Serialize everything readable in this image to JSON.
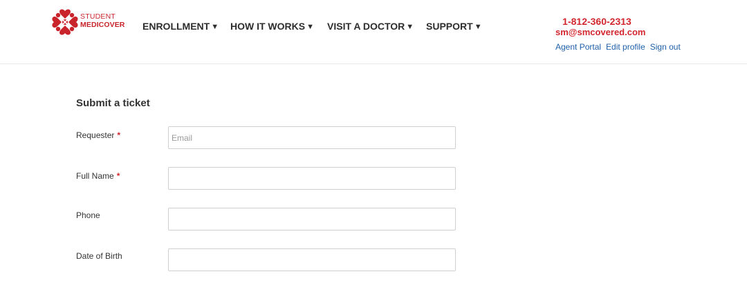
{
  "brand": {
    "line1": "STUDENT",
    "line2": "MEDICOVER",
    "logo_icon": "heart-cluster-icon",
    "color": "#c9242b"
  },
  "nav": {
    "items": [
      {
        "label": "ENROLLMENT",
        "caret": "▼"
      },
      {
        "label": "HOW IT WORKS",
        "caret": "▼"
      },
      {
        "label": "VISIT A DOCTOR",
        "caret": "▼"
      },
      {
        "label": "SUPPORT",
        "caret": "▼"
      }
    ]
  },
  "contact": {
    "phone": "1-812-360-2313",
    "email": "sm@smcovered.com",
    "color": "#d2272e"
  },
  "account_links": {
    "agent_portal": "Agent Portal",
    "edit_profile": "Edit profile",
    "sign_out": "Sign out",
    "color": "#1f5fa8"
  },
  "form": {
    "title": "Submit a ticket",
    "required_marker": "*",
    "fields": [
      {
        "label": "Requester",
        "required": true,
        "placeholder": "Email",
        "value": ""
      },
      {
        "label": "Full Name",
        "required": true,
        "placeholder": "",
        "value": ""
      },
      {
        "label": "Phone",
        "required": false,
        "placeholder": "",
        "value": ""
      },
      {
        "label": "Date of Birth",
        "required": false,
        "placeholder": "",
        "value": ""
      }
    ]
  }
}
